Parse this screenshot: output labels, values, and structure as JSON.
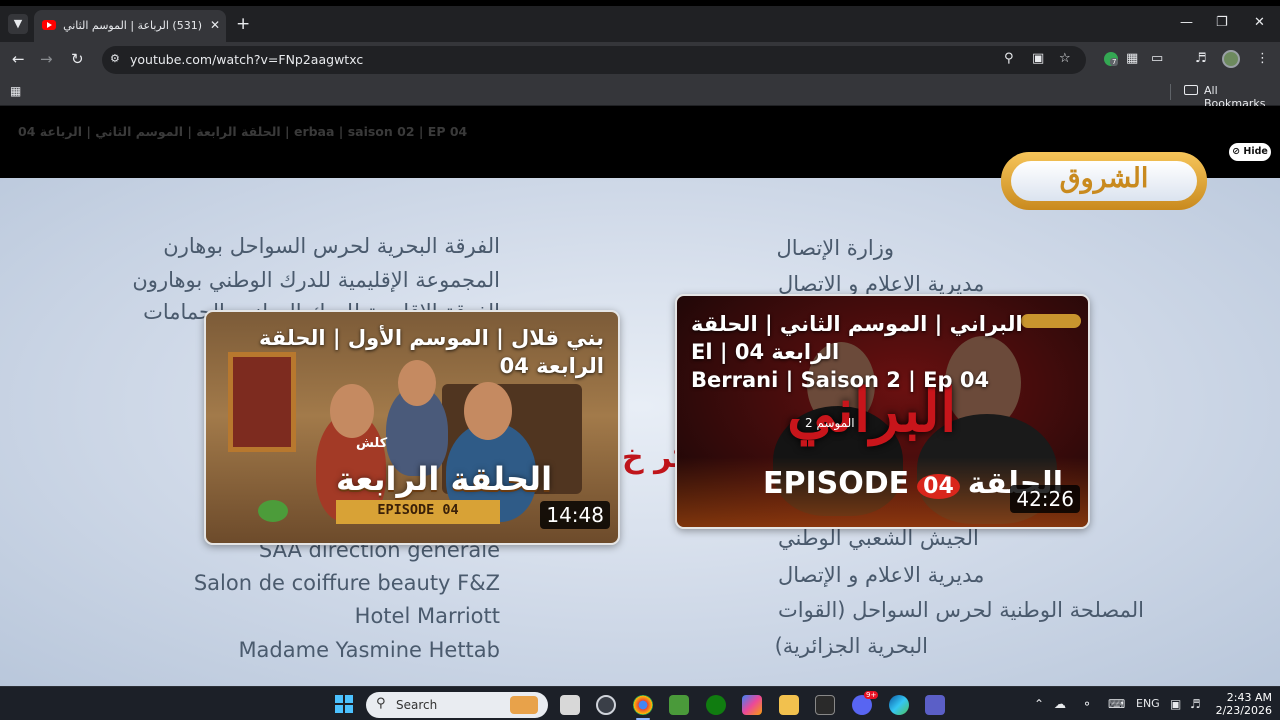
{
  "browser": {
    "tab_title": "(531) الرباعة | الموسم الثاني | الح",
    "new_tab": "+",
    "url": "youtube.com/watch?v=FNp2aagwtxc",
    "bookmarks_label": "All Bookmarks",
    "ext_badge_count": "7"
  },
  "video": {
    "overlay_title": "04 الحلقة الرابعة | الموسم الثاني | الرباعة | erbaa | saison 02 | EP 04",
    "hide_button": "Hide",
    "channel_logo": "الشروق",
    "credits_left": [
      "الفرقة البحرية لحرس السواحل بوهارن",
      "المجموعة الإقليمية للدرك الوطني بوهارون",
      "الفرقة الإقليمية للدرك الوطني بالحمامات",
      "SAA direction générale",
      "Salon de coiffure beauty F&Z",
      "Hotel Marriott",
      "Madame Yasmine Hettab"
    ],
    "credits_right": [
      "وزارة الإتصال",
      "مديرية  الاعلام و الاتصال",
      "الجيش الشعبي الوطني",
      "مديرية  الاعلام و الإتصال",
      "المصلحة الوطنية لحرس السواحل (القوات",
      "البحرية الجزائرية)"
    ],
    "center_fragment": "كر خ"
  },
  "end_cards": [
    {
      "title": "بني قلال | الموسم الأول | الحلقة الرابعة 04",
      "duration": "14:48",
      "thumb_episode_ar": "الحلقة الرابعة",
      "thumb_episode_en": "EPISODE 04",
      "thumb_sign": "كلش"
    },
    {
      "title_line1": "البراني | الموسم الثاني | الحلقة الرابعة 04 | El",
      "title_line2": "Berrani | Saison 2 | Ep 04",
      "duration": "42:26",
      "thumb_title": "البراني",
      "thumb_season": "الموسم 2",
      "thumb_episode_en": "EPISODE",
      "thumb_episode_num": "04",
      "thumb_episode_ar": "الحلقة"
    }
  ],
  "taskbar": {
    "search_placeholder": "Search",
    "language": "ENG",
    "time": "2:43 AM",
    "date": "2/23/2026",
    "discord_badge": "9+"
  }
}
